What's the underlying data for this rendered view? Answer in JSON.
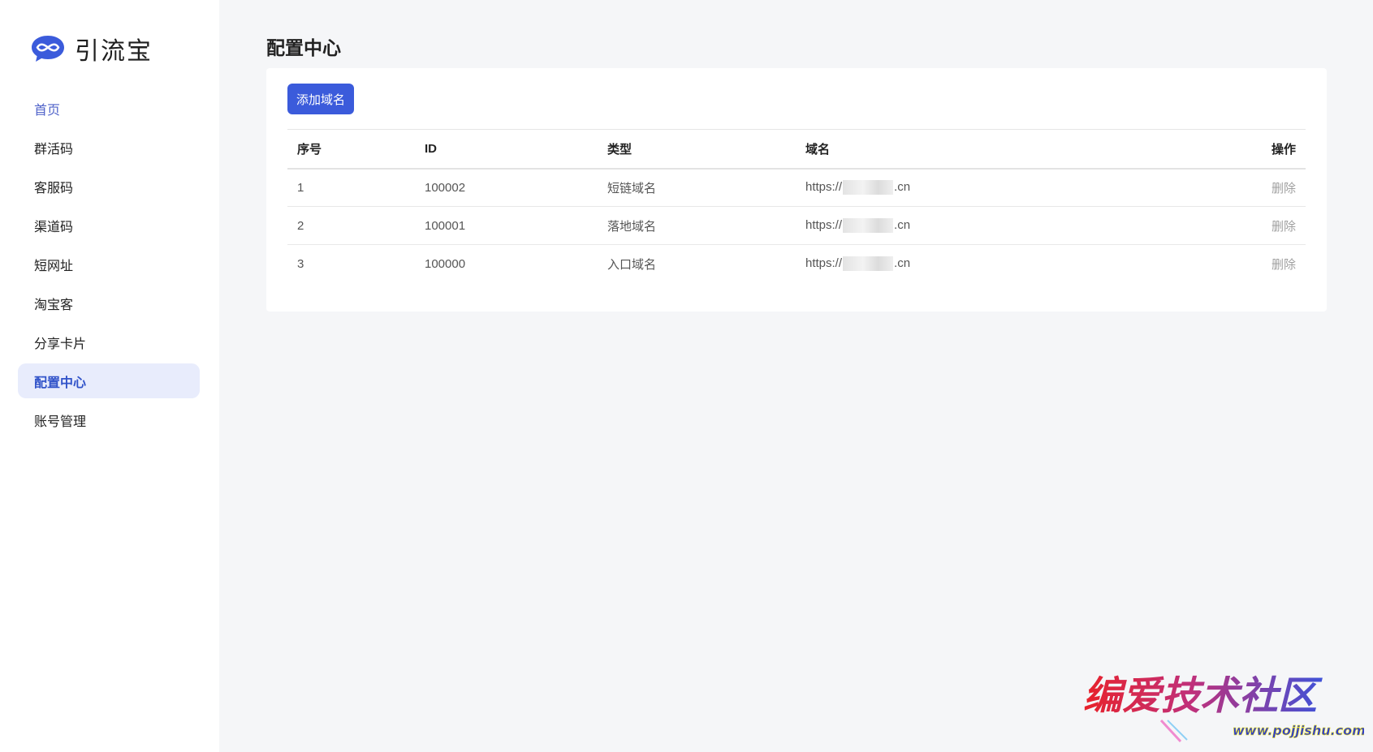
{
  "brand": {
    "name": "引流宝",
    "logo_icon": "chat-bubble-infinity-icon",
    "accent": "#3b5bdb"
  },
  "sidebar": {
    "items": [
      {
        "label": "首页"
      },
      {
        "label": "群活码"
      },
      {
        "label": "客服码"
      },
      {
        "label": "渠道码"
      },
      {
        "label": "短网址"
      },
      {
        "label": "淘宝客"
      },
      {
        "label": "分享卡片"
      },
      {
        "label": "配置中心"
      },
      {
        "label": "账号管理"
      }
    ],
    "active": "配置中心"
  },
  "main": {
    "title": "配置中心",
    "add_button": "添加域名",
    "table": {
      "headers": {
        "index": "序号",
        "id": "ID",
        "type": "类型",
        "domain": "域名",
        "action": "操作"
      },
      "rows": [
        {
          "index": "1",
          "id": "100002",
          "type": "短链域名",
          "domain_prefix": "https://",
          "domain_suffix": ".cn",
          "action": "删除"
        },
        {
          "index": "2",
          "id": "100001",
          "type": "落地域名",
          "domain_prefix": "https://",
          "domain_suffix": ".cn",
          "action": "删除"
        },
        {
          "index": "3",
          "id": "100000",
          "type": "入口域名",
          "domain_prefix": "https://",
          "domain_suffix": ".cn",
          "action": "删除"
        }
      ]
    }
  },
  "watermark": {
    "text": "编爱技术社区",
    "url": "www.pojjishu.com"
  }
}
